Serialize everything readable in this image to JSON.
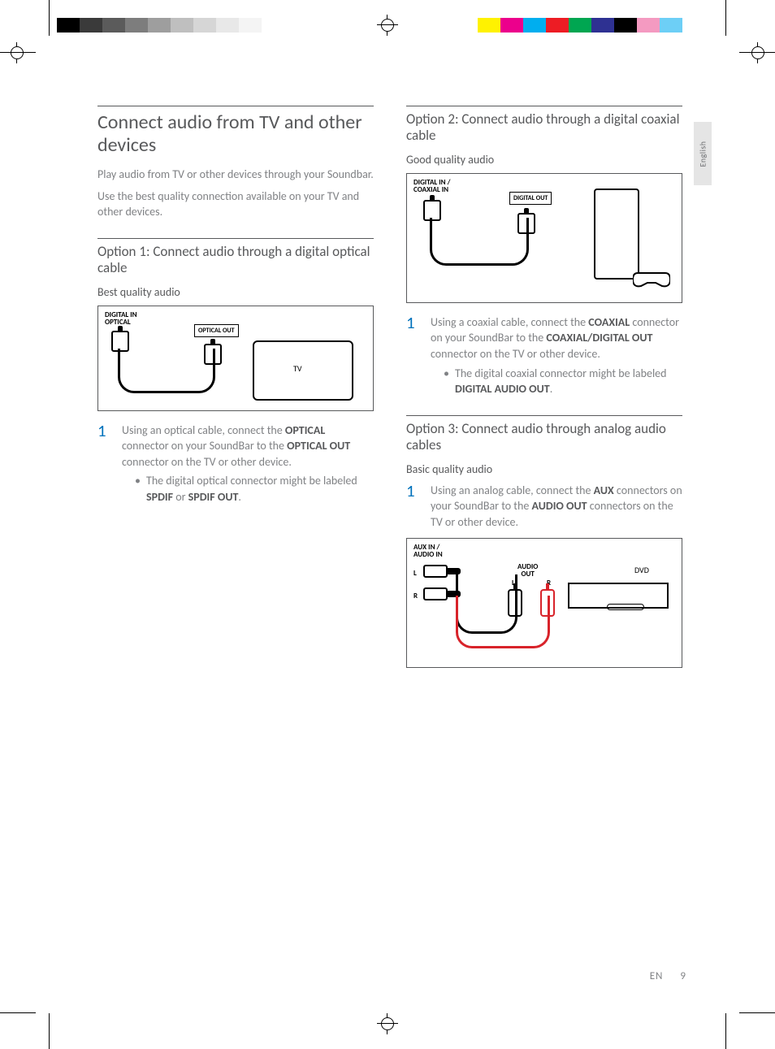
{
  "printbars": {
    "left_colors": [
      "#000000",
      "#3a3a3a",
      "#5b5b5b",
      "#7d7d7d",
      "#9e9e9e",
      "#bfbfbf",
      "#d6d6d6",
      "#e8e8e8",
      "#f4f4f4",
      "#ffffff"
    ],
    "right_colors": [
      "#ffffff",
      "#fff200",
      "#ec008c",
      "#00aeef",
      "#ed1c24",
      "#00a651",
      "#2e3192",
      "#000000",
      "#f49ac1",
      "#6dcff6"
    ]
  },
  "language_tab": "English",
  "section_title": "Connect audio from TV and other devices",
  "intro_1": "Play audio from TV or other devices through your Soundbar.",
  "intro_2": "Use the best quality connection available on your TV and other devices.",
  "option1": {
    "title": "Option 1: Connect audio through a digital optical cable",
    "quality": "Best quality audio",
    "diagram": {
      "label_in": "DIGITAL IN\nOPTICAL",
      "label_out": "OPTICAL OUT",
      "device": "TV"
    },
    "step_prefix": "Using an optical cable, connect the ",
    "step_bold1": "OPTICAL",
    "step_mid": " connector on your SoundBar to the ",
    "step_bold2": "OPTICAL OUT",
    "step_suffix": " connector on the TV or other device.",
    "bullet_prefix": "The digital optical connector might be labeled ",
    "bullet_bold1": "SPDIF",
    "bullet_mid": " or ",
    "bullet_bold2": "SPDIF OUT",
    "bullet_suffix": "."
  },
  "option2": {
    "title": "Option 2: Connect audio through a digital coaxial cable",
    "quality": "Good quality audio",
    "diagram": {
      "label_in": "DIGITAL IN /\nCOAXIAL IN",
      "label_out": "DIGITAL OUT"
    },
    "step_prefix": "Using a coaxial cable, connect the ",
    "step_bold1": "COAXIAL",
    "step_mid": " connector on your SoundBar to the ",
    "step_bold2": "COAXIAL/DIGITAL OUT",
    "step_suffix": " connector on the TV or other device.",
    "bullet_prefix": "The digital coaxial connector might be labeled ",
    "bullet_bold1": "DIGITAL AUDIO OUT",
    "bullet_suffix": "."
  },
  "option3": {
    "title": "Option 3: Connect audio through analog audio cables",
    "quality": "Basic quality audio",
    "step_prefix": "Using an analog cable, connect the ",
    "step_bold1": "AUX",
    "step_mid": " connectors on your SoundBar to the ",
    "step_bold2": "AUDIO OUT",
    "step_suffix": " connectors on the TV or other device.",
    "diagram": {
      "label_in": "AUX IN /\nAUDIO IN",
      "label_l": "L",
      "label_r": "R",
      "label_out": "AUDIO\nOUT",
      "device": "DVD"
    }
  },
  "footer": {
    "lang": "EN",
    "page": "9"
  }
}
